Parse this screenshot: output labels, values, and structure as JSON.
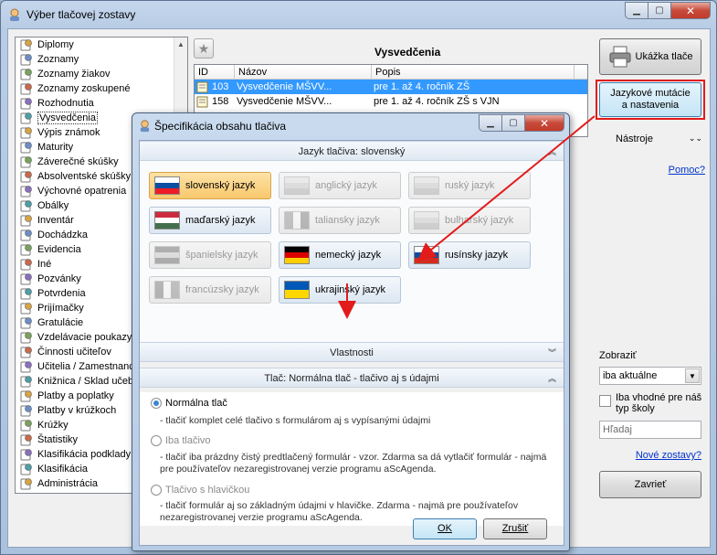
{
  "window": {
    "title": "Výber tlačovej zostavy"
  },
  "tree": {
    "items": [
      {
        "label": "Diplomy"
      },
      {
        "label": "Zoznamy"
      },
      {
        "label": "Zoznamy žiakov"
      },
      {
        "label": "Zoznamy zoskupené"
      },
      {
        "label": "Rozhodnutia"
      },
      {
        "label": "Vysvedčenia",
        "selected": true
      },
      {
        "label": "Výpis známok"
      },
      {
        "label": "Maturity"
      },
      {
        "label": "Záverečné skúšky"
      },
      {
        "label": "Absolventské skúšky"
      },
      {
        "label": "Výchovné opatrenia"
      },
      {
        "label": "Obálky"
      },
      {
        "label": "Inventár"
      },
      {
        "label": "Dochádzka"
      },
      {
        "label": "Evidencia"
      },
      {
        "label": "Iné"
      },
      {
        "label": "Pozvánky"
      },
      {
        "label": "Potvrdenia"
      },
      {
        "label": "Prijímačky"
      },
      {
        "label": "Gratulácie"
      },
      {
        "label": "Vzdelávacie poukazy"
      },
      {
        "label": "Činnosti učiteľov"
      },
      {
        "label": "Učitelia / Zamestnanci"
      },
      {
        "label": "Knižnica / Sklad učebníc"
      },
      {
        "label": "Platby a poplatky"
      },
      {
        "label": "Platby v krúžkoch"
      },
      {
        "label": "Krúžky"
      },
      {
        "label": "Štatistiky"
      },
      {
        "label": "Klasifikácia podklady"
      },
      {
        "label": "Klasifikácia"
      },
      {
        "label": "Administrácia"
      }
    ]
  },
  "list": {
    "title": "Vysvedčenia",
    "columns": [
      "ID",
      "Názov",
      "Popis"
    ],
    "rows": [
      {
        "id": "103",
        "name": "Vysvedčenie MŠVV...",
        "desc": "pre 1. až 4. ročník ZŠ"
      },
      {
        "id": "158",
        "name": "Vysvedčenie MŠVV...",
        "desc": "pre 1. až 4. ročník ZŠ s VJN"
      }
    ]
  },
  "right": {
    "preview_label": "Ukážka tlače",
    "lang_button": [
      "Jazykové mutácie",
      "a nastavenia"
    ],
    "tools_label": "Nástroje",
    "help_link": "Pomoc?",
    "show_label": "Zobraziť",
    "show_value": "iba aktuálne",
    "checkbox_label": "Iba vhodné pre náš typ školy",
    "search_placeholder": "Hľadaj",
    "new_link": "Nové zostavy?",
    "close_label": "Zavrieť"
  },
  "dialog": {
    "title": "Špecifikácia obsahu tlačiva",
    "lang_section": "Jazyk tlačiva: slovenský",
    "props_section": "Vlastnosti",
    "print_section": "Tlač: Normálna tlač - tlačivo aj s údajmi",
    "languages": [
      {
        "label": "slovenský jazyk",
        "state": "active"
      },
      {
        "label": "anglický jazyk",
        "state": "disabled"
      },
      {
        "label": "ruský jazyk",
        "state": "disabled"
      },
      {
        "label": "maďarský jazyk",
        "state": "normal"
      },
      {
        "label": "taliansky jazyk",
        "state": "disabled"
      },
      {
        "label": "bulharský jazyk",
        "state": "disabled"
      },
      {
        "label": "španielsky jazyk",
        "state": "disabled"
      },
      {
        "label": "nemecký jazyk",
        "state": "normal"
      },
      {
        "label": "rusínsky jazyk",
        "state": "normal"
      },
      {
        "label": "francúzsky jazyk",
        "state": "disabled"
      },
      {
        "label": "ukrajinský jazyk",
        "state": "normal"
      }
    ],
    "options": [
      {
        "label": "Normálna tlač",
        "desc": "- tlačiť komplet celé tlačivo s formulárom aj s vypísanými údajmi",
        "selected": true
      },
      {
        "label": "Iba tlačivo",
        "desc": "- tlačiť iba prázdny čistý predtlačený formulár - vzor. Zdarma sa dá vytlačiť formulár - najmä pre používateľov nezaregistrovanej verzie programu aScAgenda.",
        "selected": false
      },
      {
        "label": "Tlačivo s hlavičkou",
        "desc": "- tlačiť formulár aj so základným údajmi v hlavičke. Zdarma  - najmä pre používateľov nezaregistrovanej verzie programu aScAgenda.",
        "selected": false
      }
    ],
    "ok_label": "OK",
    "cancel_label": "Zrušiť"
  },
  "colors": {
    "accent": "#3399ff",
    "highlight_border": "#e21b1b",
    "link": "#0033cc"
  }
}
